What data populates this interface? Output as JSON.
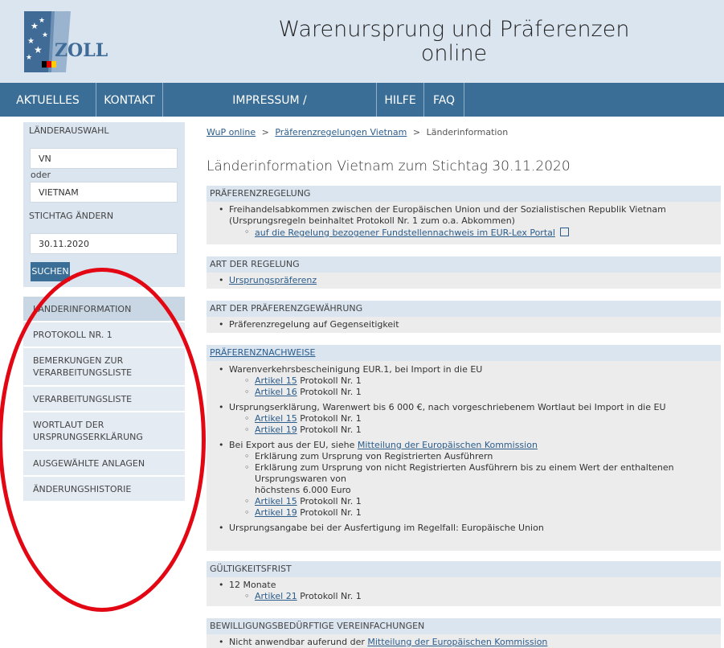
{
  "header": {
    "title_line1": "Warenursprung und Präferenzen",
    "title_line2": "online",
    "logo_text": "ZOLL"
  },
  "nav": {
    "items": [
      "AKTUELLES",
      "KONTAKT",
      "IMPRESSUM / HAFTUNGSAUSSCHLUSS",
      "HILFE",
      "FAQ"
    ]
  },
  "sidebar": {
    "laenderauswahl_label": "LÄNDERAUSWAHL",
    "country_code": "VN",
    "oder": "oder",
    "country_name": "VIETNAM",
    "stichtag_label": "STICHTAG ÄNDERN",
    "date": "30.11.2020",
    "search_label": "SUCHEN",
    "menu": [
      "LÄNDERINFORMATION",
      "PROTOKOLL NR. 1",
      "BEMERKUNGEN ZUR VERARBEITUNGSLISTE",
      "VERARBEITUNGSLISTE",
      "WORTLAUT DER URSPRUNGSERKLÄRUNG",
      "AUSGEWÄHLTE ANLAGEN",
      "ÄNDERUNGSHISTORIE"
    ]
  },
  "breadcrumb": {
    "home": "WuP online",
    "sep": ">",
    "parent": "Präferenzregelungen Vietnam",
    "current": "Länderinformation"
  },
  "page_title": "Länderinformation Vietnam zum Stichtag 30.11.2020",
  "sections": {
    "praeferenzregelung": {
      "heading": "PRÄFERENZREGELUNG",
      "line1": "Freihandelsabkommen zwischen der Europäischen Union und der Sozialistischen Republik Vietnam",
      "line2": "(Ursprungsregeln beinhaltet Protokoll Nr. 1 zum o.a. Abkommen)",
      "link": "auf die Regelung bezogener Fundstellennachweis im EUR-Lex Portal"
    },
    "art_regelung": {
      "heading": "ART DER REGELUNG",
      "link": "Ursprungspräferenz"
    },
    "art_gewaehrung": {
      "heading": "ART DER PRÄFERENZGEWÄHRUNG",
      "text": "Präferenzregelung auf Gegenseitigkeit"
    },
    "nachweise": {
      "heading": "PRÄFERENZNACHWEISE",
      "item1": "Warenverkehrsbescheinigung EUR.1, bei Import in die EU",
      "art15": "Artikel 15",
      "art16": "Artikel 16",
      "art19": "Artikel 19",
      "protokoll": "Protokoll Nr. 1",
      "item2": "Ursprungserklärung, Warenwert bis 6 000 €, nach vorgeschriebenem Wortlaut bei Import in die EU",
      "item3_prefix": "Bei Export aus der EU, siehe",
      "item3_link": "Mitteilung der Europäischen Kommission",
      "sub_reg": "Erklärung zum Ursprung von Registrierten Ausführern",
      "sub_nreg1": "Erklärung zum Ursprung von nicht Registrierten Ausführern bis zu einem Wert der enthaltenen Ursprungswaren von",
      "sub_nreg2": "höchstens 6.000 Euro",
      "item4": "Ursprungsangabe bei der Ausfertigung im Regelfall: Europäische Union"
    },
    "gueltigkeit": {
      "heading": "GÜLTIGKEITSFRIST",
      "item": "12 Monate",
      "art21": "Artikel 21",
      "protokoll": "Protokoll Nr. 1"
    },
    "vereinfachungen": {
      "heading": "BEWILLIGUNGSBEDÜRFTIGE VEREINFACHUNGEN",
      "prefix": "Nicht anwendbar auferund der",
      "link": "Mitteilung der Europäischen Kommission"
    }
  },
  "colors": {
    "header_bg": "#dbe5f0",
    "nav_bg": "#3a6e97",
    "highlight_ellipse": "#e30613"
  }
}
